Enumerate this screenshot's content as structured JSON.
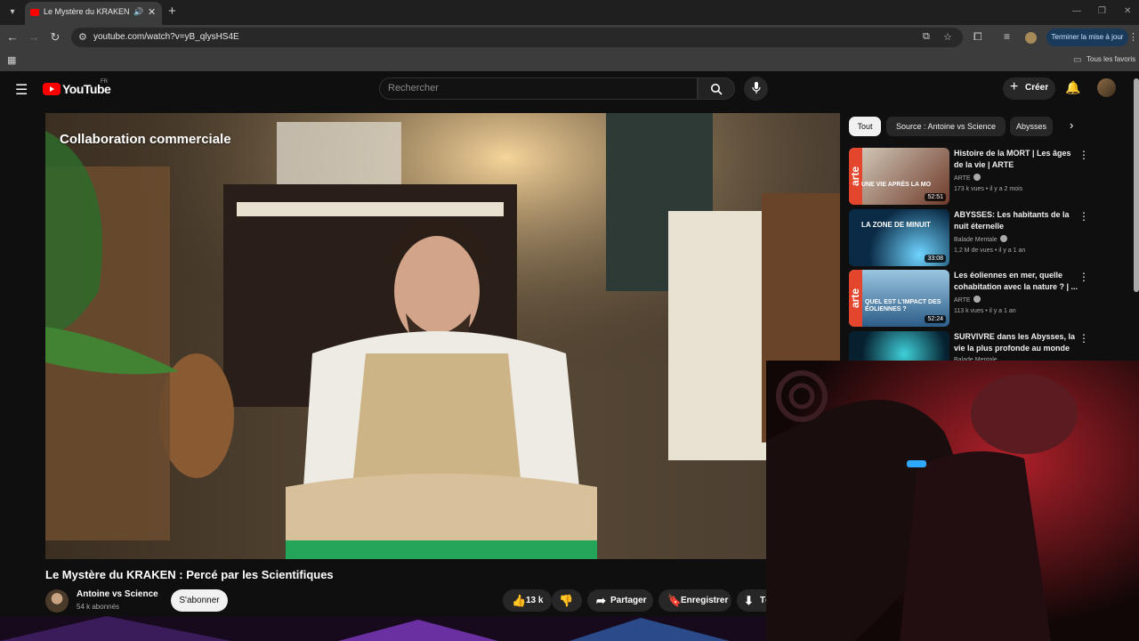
{
  "browser": {
    "tab_title": "Le Mystère du KRAKEN : Perc",
    "url": "youtube.com/watch?v=yB_qlysHS4E",
    "update_button": "Terminer la mise à jour",
    "bookmarks_folder": "Tous les favoris"
  },
  "youtube": {
    "brand": "YouTube",
    "region": "FR",
    "search_placeholder": "Rechercher",
    "create_label": "Créer"
  },
  "video": {
    "overlay_text": "Collaboration commerciale",
    "title": "Le Mystère du KRAKEN : Percé par les Scientifiques",
    "channel_name": "Antoine vs Science",
    "subscribers": "54 k abonnés",
    "subscribe_label": "S'abonner",
    "likes": "13 k",
    "share_label": "Partager",
    "save_label": "Enregistrer",
    "download_label": "Té"
  },
  "chips": [
    "Tout",
    "Source : Antoine vs Science",
    "Abysses"
  ],
  "related": [
    {
      "title": "Histoire de la MORT | Les âges de la vie | ARTE",
      "channel": "ARTE",
      "meta": "173 k vues • il y a 2 mois",
      "duration": "52:51",
      "thumb_text": "UNE VIE APRÈS LA MO",
      "arte": "arte"
    },
    {
      "title": "ABYSSES: Les habitants de la nuit éternelle",
      "channel": "Balade Mentale",
      "meta": "1,2 M de vues • il y a 1 an",
      "duration": "33:08",
      "thumb_text": "LA ZONE DE MINUIT"
    },
    {
      "title": "Les éoliennes en mer, quelle cohabitation avec la nature ? | ...",
      "channel": "ARTE",
      "meta": "113 k vues • il y a 1 an",
      "duration": "52:24",
      "thumb_text": "QUEL EST L'IMPACT DES ÉOLIENNES ?",
      "arte": "arte"
    },
    {
      "title": "SURVIVRE dans les Abysses, la vie la plus profonde au monde",
      "channel": "Balade Mentale",
      "meta": "",
      "duration": "",
      "thumb_text": ""
    }
  ]
}
